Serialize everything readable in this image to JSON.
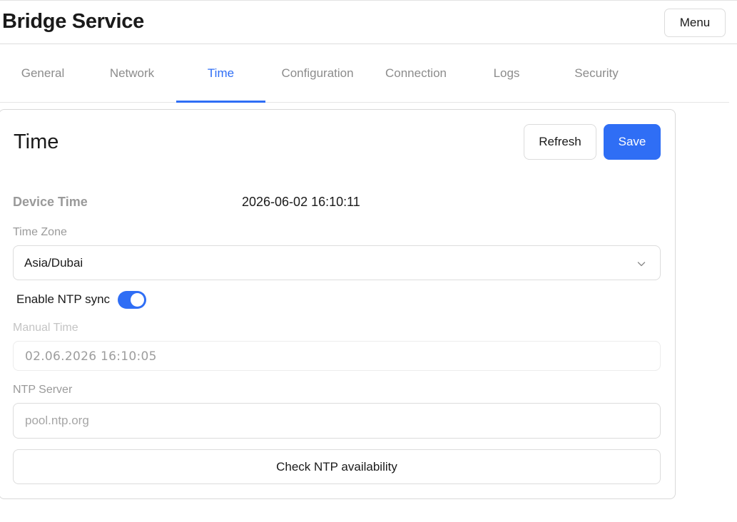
{
  "app": {
    "title": "Bridge Service",
    "menu_label": "Menu"
  },
  "tabs": [
    {
      "label": "General",
      "active": false
    },
    {
      "label": "Network",
      "active": false
    },
    {
      "label": "Time",
      "active": true
    },
    {
      "label": "Configuration",
      "active": false
    },
    {
      "label": "Connection",
      "active": false
    },
    {
      "label": "Logs",
      "active": false
    },
    {
      "label": "Security",
      "active": false
    }
  ],
  "panel": {
    "title": "Time",
    "refresh_label": "Refresh",
    "save_label": "Save",
    "device_time_label": "Device Time",
    "device_time_value": "2026-06-02 16:10:11",
    "time_zone_label": "Time Zone",
    "time_zone_value": "Asia/Dubai",
    "ntp_sync_label": "Enable NTP sync",
    "ntp_sync_enabled": true,
    "manual_time_label": "Manual Time",
    "manual_time_value": "02.06.2026 16:10:05",
    "ntp_server_label": "NTP Server",
    "ntp_server_placeholder": "pool.ntp.org",
    "check_ntp_label": "Check NTP availability"
  },
  "colors": {
    "accent": "#2f6ef5",
    "muted_text": "#9a9a9a",
    "border": "#dcdcdc"
  },
  "icons": {
    "select_arrow": "chevron-down-icon"
  }
}
